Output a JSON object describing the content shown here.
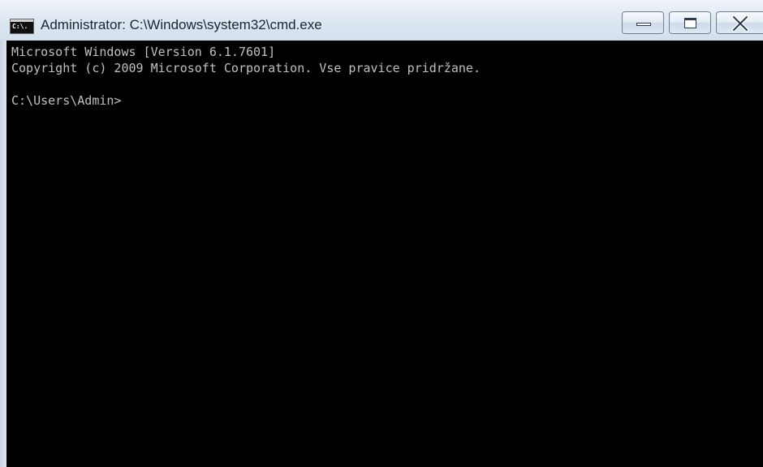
{
  "window": {
    "title": "Administrator: C:\\Windows\\system32\\cmd.exe",
    "icon_label": "C:\\.",
    "icon": "cmd-console-icon"
  },
  "caption_buttons": {
    "minimize_icon": "minimize-icon",
    "maximize_icon": "maximize-icon",
    "close_icon": "close-icon"
  },
  "console": {
    "lines": [
      "Microsoft Windows [Version 6.1.7601]",
      "Copyright (c) 2009 Microsoft Corporation. Vse pravice pridržane.",
      "",
      "C:\\Users\\Admin>"
    ],
    "background": "#000000",
    "foreground": "#c0c0c0"
  }
}
